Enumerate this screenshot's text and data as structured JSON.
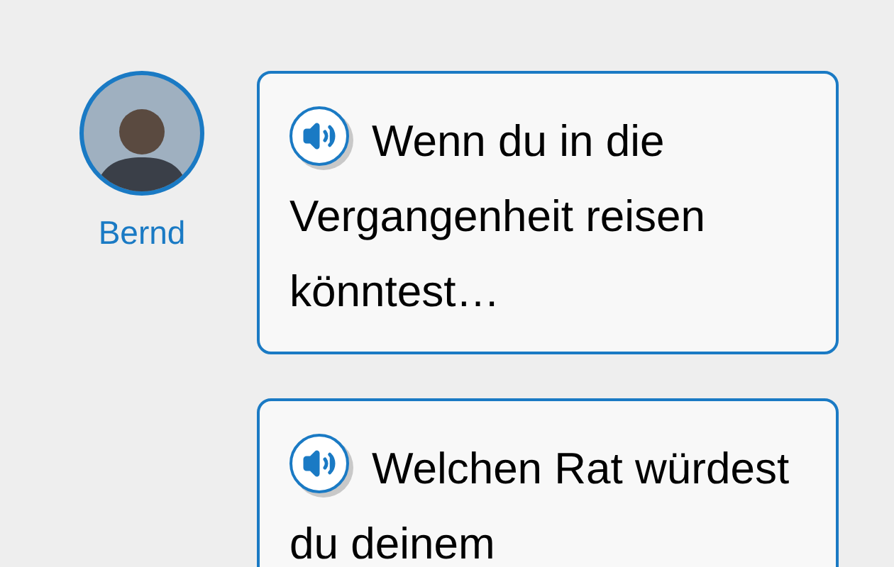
{
  "sender": {
    "name": "Bernd"
  },
  "messages": [
    {
      "text": "Wenn du in die Vergangenheit reisen könntest…"
    },
    {
      "text": "Welchen Rat würdest du deinem"
    }
  ]
}
